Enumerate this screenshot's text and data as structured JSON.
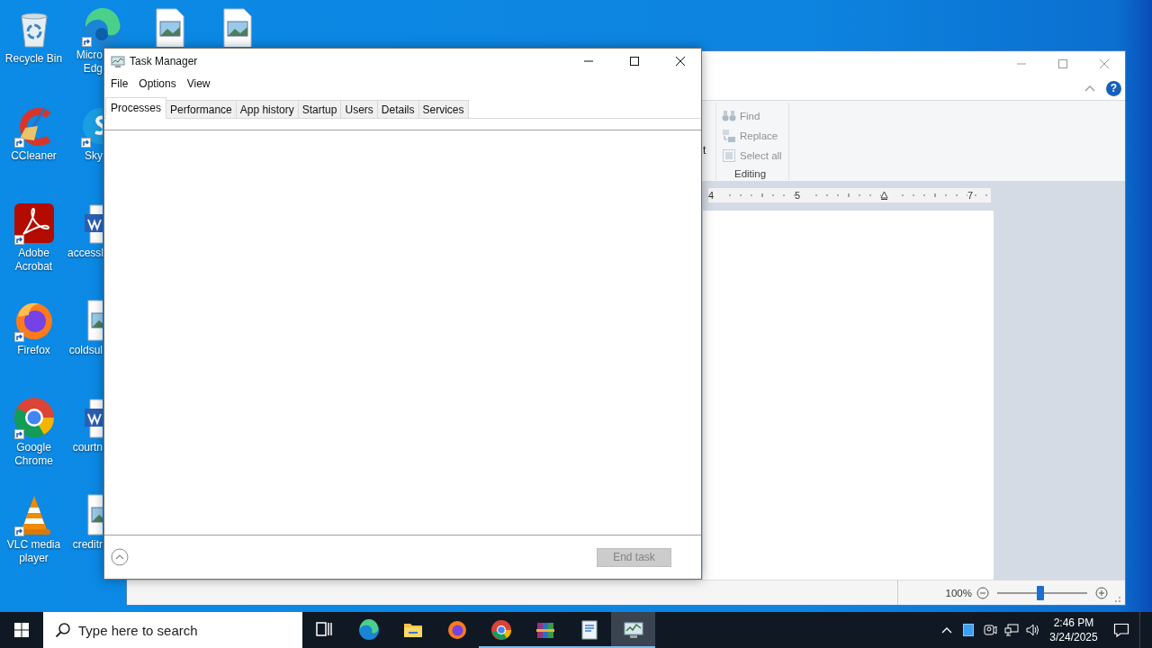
{
  "desktop": {
    "columns": [
      {
        "covered": false,
        "icons": [
          {
            "kind": "recycle-bin",
            "label": "Recycle Bin",
            "shortcut": false
          },
          {
            "kind": "ccleaner",
            "label": "CCleaner",
            "shortcut": true
          },
          {
            "kind": "acrobat",
            "label": "Adobe Acrobat",
            "shortcut": true
          },
          {
            "kind": "firefox",
            "label": "Firefox",
            "shortcut": true
          },
          {
            "kind": "chrome",
            "label": "Google Chrome",
            "shortcut": true
          },
          {
            "kind": "vlc",
            "label": "VLC media player",
            "shortcut": true
          }
        ]
      },
      {
        "covered": true,
        "icons": [
          {
            "kind": "edge",
            "label": "Micro Edg",
            "shortcut": true
          },
          {
            "kind": "skype",
            "label": "Sky",
            "shortcut": true
          },
          {
            "kind": "word-doc",
            "label": "accessl",
            "shortcut": false
          },
          {
            "kind": "image-file",
            "label": "coldsul",
            "shortcut": false
          },
          {
            "kind": "word-doc",
            "label": "courtn",
            "shortcut": false
          },
          {
            "kind": "image-file",
            "label": "creditr",
            "shortcut": false
          }
        ]
      },
      {
        "covered": true,
        "icons": [
          {
            "kind": "image-file",
            "shortcut": false
          }
        ]
      },
      {
        "covered": true,
        "icons": [
          {
            "kind": "image-file",
            "shortcut": false
          }
        ]
      }
    ]
  },
  "wordpad": {
    "help": "?",
    "ribbon_fragment": "t",
    "editing": {
      "title": "Editing",
      "items": [
        {
          "kind": "find",
          "label": "Find",
          "disabled": true
        },
        {
          "kind": "replace",
          "label": "Replace",
          "disabled": true
        },
        {
          "kind": "select-all",
          "label": "Select all",
          "disabled": true
        }
      ]
    },
    "ruler": [
      {
        "kind": "number",
        "label": "4"
      },
      {
        "kind": "number",
        "label": "5"
      },
      {
        "kind": "indent-marker"
      },
      {
        "kind": "number",
        "label": "7"
      }
    ],
    "zoom": {
      "reading": "100%",
      "level": 0.48
    }
  },
  "task_manager": {
    "title": "Task Manager",
    "menu": [
      "File",
      "Options",
      "View"
    ],
    "tabs": [
      {
        "label": "Processes",
        "selected": true
      },
      {
        "label": "Performance",
        "selected": false
      },
      {
        "label": "App history",
        "selected": false
      },
      {
        "label": "Startup",
        "selected": false
      },
      {
        "label": "Users",
        "selected": false
      },
      {
        "label": "Details",
        "selected": false
      },
      {
        "label": "Services",
        "selected": false
      }
    ],
    "end_task": {
      "label": "End task",
      "disabled": true
    }
  },
  "taskbar": {
    "search": {
      "placeholder": "Type here to search"
    },
    "apps": [
      {
        "kind": "task-view",
        "running": false,
        "active": false
      },
      {
        "kind": "edge",
        "running": false,
        "active": false
      },
      {
        "kind": "explorer",
        "running": false,
        "active": false
      },
      {
        "kind": "firefox",
        "running": false,
        "active": false
      },
      {
        "kind": "chrome",
        "running": true,
        "active": false
      },
      {
        "kind": "winrar",
        "running": true,
        "active": false
      },
      {
        "kind": "wordpad",
        "running": true,
        "active": false
      },
      {
        "kind": "task-manager",
        "running": true,
        "active": true
      }
    ],
    "clock": {
      "time": "2:46 PM",
      "date": "3/24/2025"
    }
  }
}
